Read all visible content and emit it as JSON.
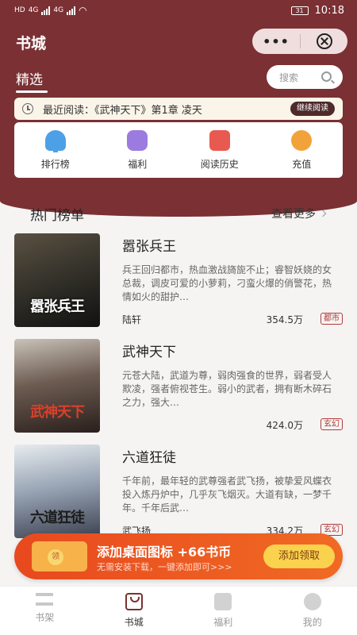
{
  "status_bar": {
    "left_tag_1": "HD",
    "left_tag_2": "4G",
    "battery": "31",
    "time": "10:18"
  },
  "header": {
    "title": "书城",
    "capsule_more": "•••",
    "tab_selected": "精选",
    "search_placeholder": "搜索"
  },
  "recent": {
    "text": "最近阅读：《武神天下》第1章 凌天",
    "button": "继续阅读"
  },
  "quick_entries": [
    "排行榜",
    "福利",
    "阅读历史",
    "充值"
  ],
  "hot": {
    "title": "热门榜单",
    "more": "查看更多",
    "books": [
      {
        "title": "嚣张兵王",
        "cover_text": "嚣张兵王",
        "desc": "兵王回归都市，热血激战旖旎不止；睿智妖娆的女总裁，调皮可爱的小萝莉，刁蛮火爆的俏警花，热情如火的甜护…",
        "author": "陆轩",
        "heat": "354.5万",
        "tag": "都市"
      },
      {
        "title": "武神天下",
        "cover_text": "武神天下",
        "desc": "元苍大陆，武道为尊，弱肉强食的世界，弱者受人欺凌，强者俯视苍生。弱小的武者，拥有断木碎石之力，强大…",
        "author": "",
        "heat": "424.0万",
        "tag": "玄幻"
      },
      {
        "title": "六道狂徒",
        "cover_text": "六道狂徒",
        "desc": "千年前，最年轻的武尊强者武飞扬，被挚爱风蝶衣投入炼丹炉中，几乎灰飞烟灭。大道有缺，一梦千年。千年后武…",
        "author": "武飞扬",
        "heat": "334.2万",
        "tag": "玄幻"
      }
    ]
  },
  "banner": {
    "main": "添加桌面图标 +66书币",
    "sub": "无需安装下载，一键添加即可>>>",
    "button": "添加领取"
  },
  "nav": [
    "书架",
    "书城",
    "福利",
    "我的"
  ],
  "colors": {
    "brand": "#7b3033",
    "banner": "#e8491e",
    "tag": "#b03a3a"
  }
}
